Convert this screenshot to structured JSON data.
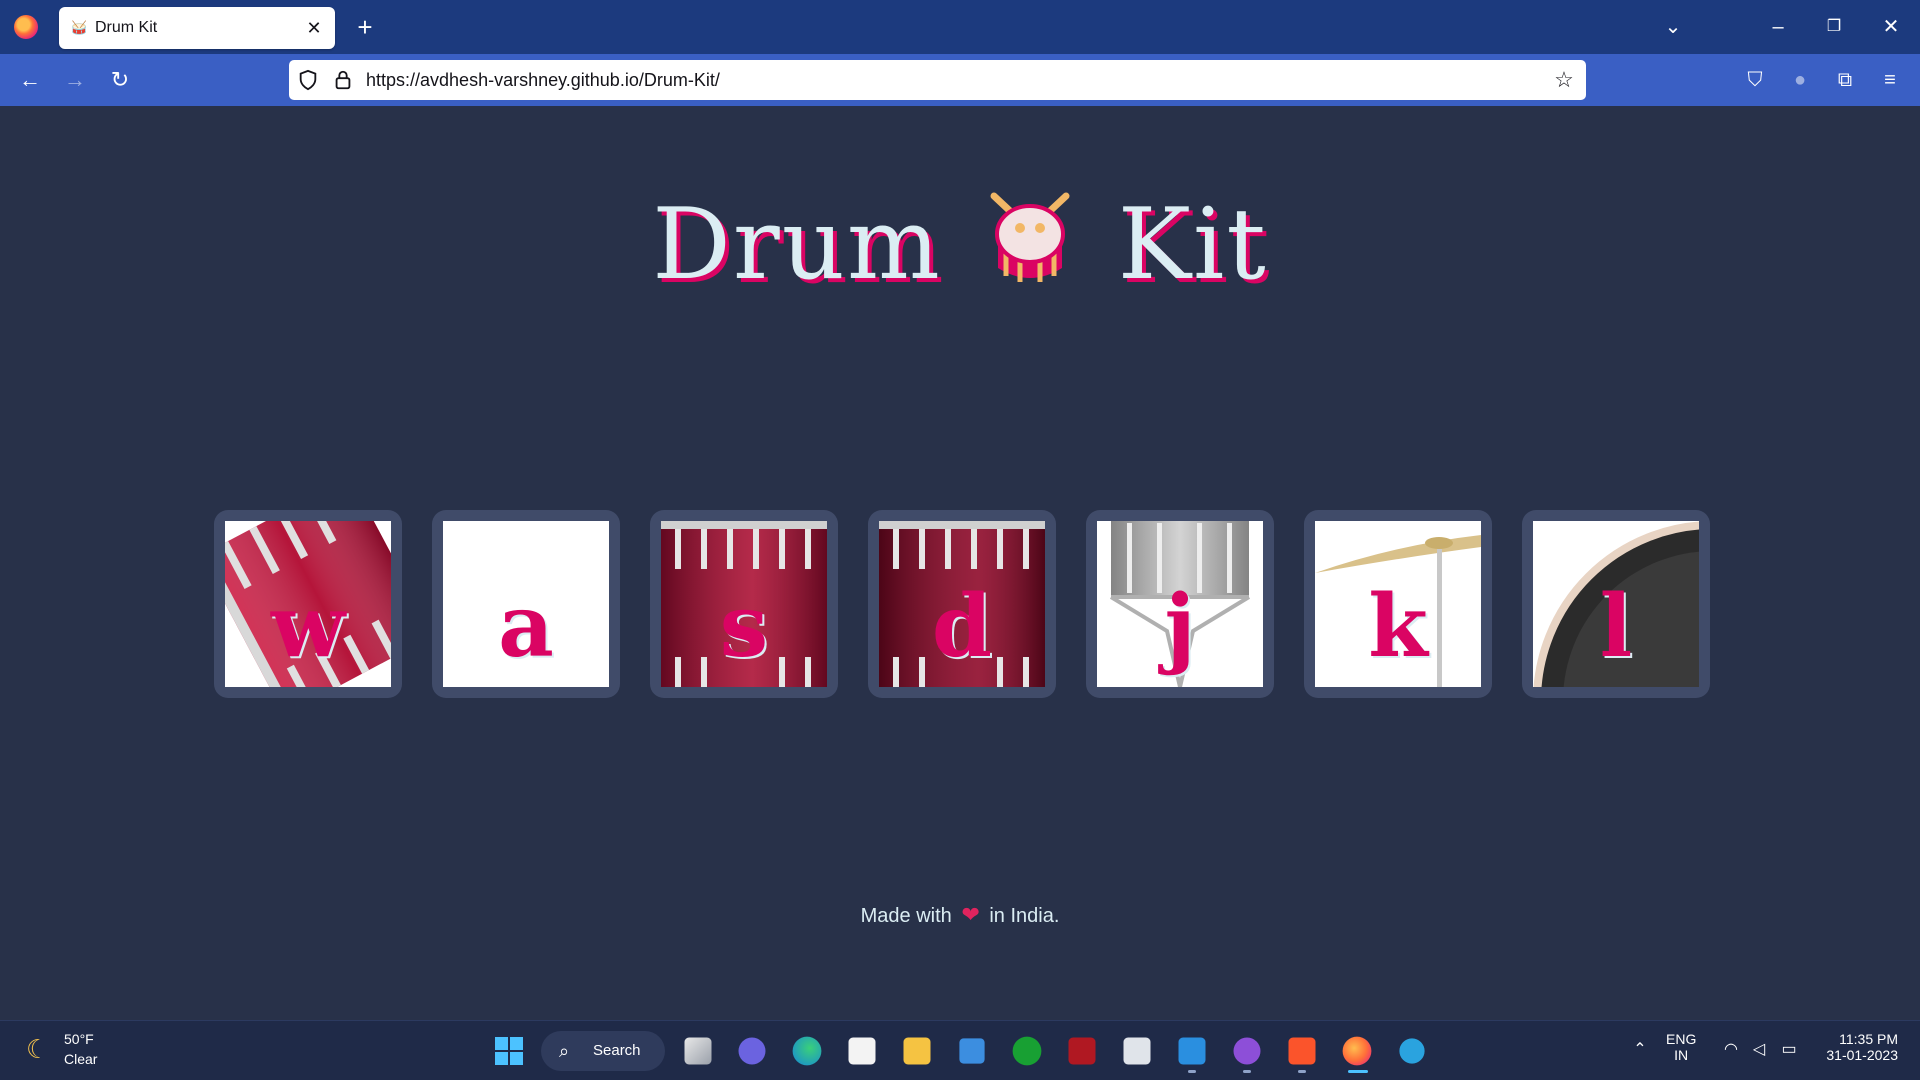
{
  "browser": {
    "tab_title": "Drum Kit",
    "tab_favicon": "drum-favicon",
    "url_host": "https://avdhesh-varshney.github.io",
    "url_path": "/Drum-Kit/"
  },
  "page": {
    "title_left": "Drum",
    "title_right": "Kit",
    "title_emoji": "drum-emoji",
    "drums": [
      {
        "key": "w",
        "image": "tom-1"
      },
      {
        "key": "a",
        "image": "blank"
      },
      {
        "key": "s",
        "image": "tom-2"
      },
      {
        "key": "d",
        "image": "tom-3"
      },
      {
        "key": "j",
        "image": "snare"
      },
      {
        "key": "k",
        "image": "crash"
      },
      {
        "key": "l",
        "image": "kick"
      }
    ],
    "footer_before": "Made with",
    "footer_after": "in India."
  },
  "taskbar": {
    "weather_temp": "50°F",
    "weather_cond": "Clear",
    "search_label": "Search",
    "lang_top": "ENG",
    "lang_bottom": "IN",
    "time": "11:35 PM",
    "date": "31-01-2023"
  },
  "colors": {
    "background": "#283149",
    "tile": "#404b69",
    "accent": "#da0463",
    "text": "#dbedf3"
  }
}
